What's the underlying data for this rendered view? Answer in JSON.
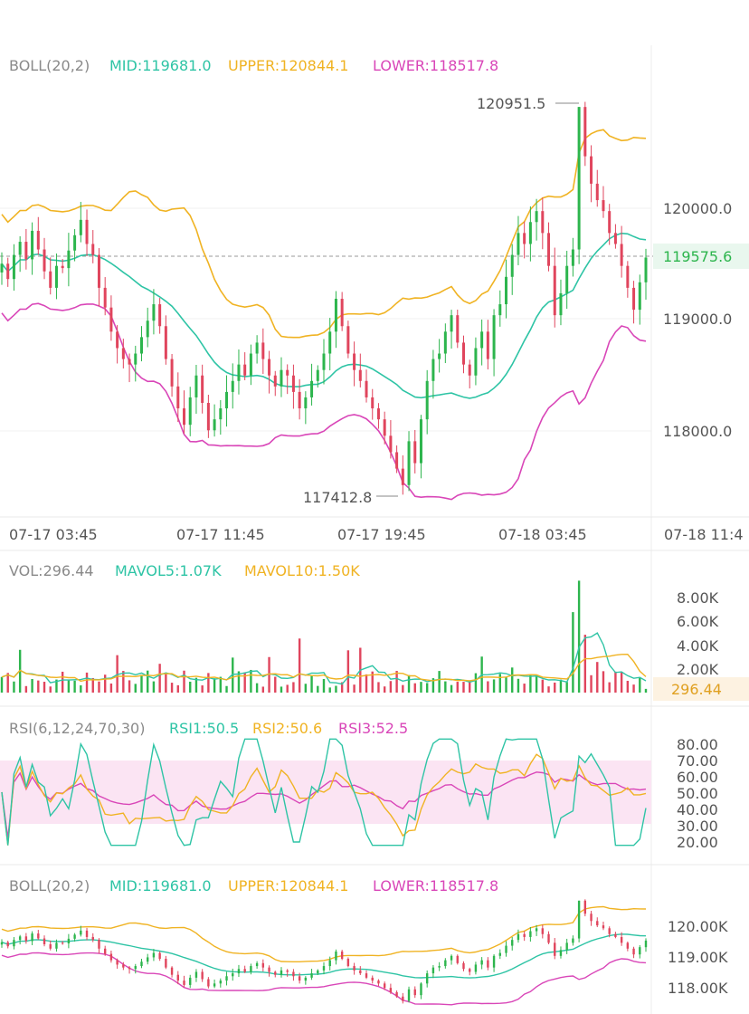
{
  "colors": {
    "mid": "#2ec4a5",
    "upper": "#f0b323",
    "lower": "#d946b8",
    "up": "#2db54d",
    "down": "#e0455d",
    "label": "#8a8a8a",
    "axis": "#555555",
    "price_tag_bg": "#e9f7ee",
    "price_tag_text": "#2db54d",
    "vol_tag_bg": "#fdf2e1",
    "vol_tag_text": "#e0a020",
    "rsi_band": "#fbe4f3"
  },
  "boll": {
    "title": "BOLL(20,2)",
    "mid": "MID:119681.0",
    "upper": "UPPER:120844.1",
    "lower": "LOWER:118517.8",
    "high_label": "120951.5",
    "low_label": "117412.8",
    "current_price": "119575.6",
    "y_ticks": [
      "120000.0",
      "119000.0",
      "118000.0"
    ]
  },
  "time_axis": [
    "07-17 03:45",
    "07-17 11:45",
    "07-17 19:45",
    "07-18 03:45",
    "07-18 11:4"
  ],
  "vol": {
    "title": "VOL:296.44",
    "mavol5": "MAVOL5:1.07K",
    "mavol10": "MAVOL10:1.50K",
    "current": "296.44",
    "y_ticks": [
      "8.00K",
      "6.00K",
      "4.00K",
      "2.00K"
    ]
  },
  "rsi": {
    "title": "RSI(6,12,24,70,30)",
    "rsi1": "RSI1:50.5",
    "rsi2": "RSI2:50.6",
    "rsi3": "RSI3:52.5",
    "y_ticks": [
      "80.00",
      "70.00",
      "60.00",
      "50.00",
      "40.00",
      "30.00",
      "20.00"
    ]
  },
  "boll2": {
    "title": "BOLL(20,2)",
    "mid": "MID:119681.0",
    "upper": "UPPER:120844.1",
    "lower": "LOWER:118517.8",
    "y_ticks": [
      "120.00K",
      "119.00K",
      "118.00K"
    ]
  },
  "chart_data": {
    "type": "candlestick",
    "indicators": [
      "BOLL(20,2)",
      "VOL",
      "RSI(6,12,24,70,30)"
    ],
    "price_ylim": [
      117300,
      121100
    ],
    "high": 120951.5,
    "low": 117412.8,
    "last": 119575.6,
    "rsi_band": [
      30,
      70
    ],
    "vol_ylim": [
      0,
      9000
    ],
    "close": [
      119520,
      119380,
      119600,
      119720,
      119560,
      119820,
      119650,
      119450,
      119300,
      119500,
      119480,
      119640,
      119780,
      119920,
      119700,
      119600,
      119300,
      119120,
      118900,
      118750,
      118650,
      118600,
      118700,
      118850,
      119000,
      119150,
      118950,
      118650,
      118400,
      118200,
      118050,
      118300,
      118500,
      118250,
      118000,
      118100,
      118200,
      118350,
      118450,
      118600,
      118500,
      118700,
      118800,
      118650,
      118500,
      118400,
      118550,
      118500,
      118350,
      118200,
      118300,
      118450,
      118550,
      118700,
      118900,
      119200,
      118950,
      118700,
      118550,
      118450,
      118300,
      118200,
      118100,
      117950,
      117800,
      117650,
      117500,
      117900,
      117700,
      118100,
      118450,
      118650,
      118700,
      118900,
      119050,
      118800,
      118600,
      118500,
      118750,
      118900,
      118650,
      119050,
      119150,
      119400,
      119600,
      119800,
      119700,
      119900,
      120000,
      119800,
      119500,
      119050,
      119250,
      119500,
      119650,
      120950,
      120500,
      120250,
      120100,
      120000,
      119800,
      119700,
      119500,
      119300,
      119100,
      119350,
      119576
    ]
  }
}
